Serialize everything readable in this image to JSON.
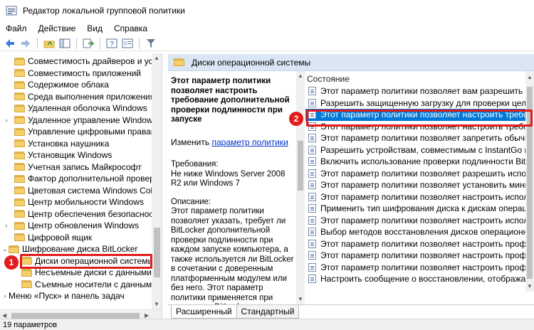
{
  "window": {
    "title": "Редактор локальной групповой политики"
  },
  "menu": [
    "Файл",
    "Действие",
    "Вид",
    "Справка"
  ],
  "toolbar": {
    "icons": [
      "back-icon",
      "forward-icon",
      "up-folder-icon",
      "show-hide-tree-icon",
      "export-list-icon",
      "help-icon",
      "properties-icon",
      "filter-icon"
    ]
  },
  "tree": {
    "items": [
      {
        "label": "Совместимость драйверов и устро",
        "expandable": false
      },
      {
        "label": "Совместимость приложений",
        "expandable": false
      },
      {
        "label": "Содержимое облака",
        "expandable": false
      },
      {
        "label": "Среда выполнения приложения",
        "expandable": false
      },
      {
        "label": "Удаленная оболочка Windows",
        "expandable": false
      },
      {
        "label": "Удаленное управление Windows",
        "expandable": true
      },
      {
        "label": "Управление цифровыми правами W",
        "expandable": false
      },
      {
        "label": "Установка наушника",
        "expandable": false
      },
      {
        "label": "Установщик Windows",
        "expandable": false
      },
      {
        "label": "Учетная запись Майкрософт",
        "expandable": false
      },
      {
        "label": "Фактор дополнительной проверки",
        "expandable": false
      },
      {
        "label": "Цветовая система Windows Color S",
        "expandable": false
      },
      {
        "label": "Центр мобильности Windows",
        "expandable": false
      },
      {
        "label": "Центр обеспечения безопасности",
        "expandable": false
      },
      {
        "label": "Центр обновления Windows",
        "expandable": true
      },
      {
        "label": "Цифровой ящик",
        "expandable": false
      },
      {
        "label": "Шифрование диска BitLocker",
        "expandable": true
      },
      {
        "label": "Диски операционной системы",
        "expandable": false
      },
      {
        "label": "Несъемные диски с данными",
        "expandable": false
      },
      {
        "label": "Съемные носители с данными",
        "expandable": false
      },
      {
        "label": "Меню «Пуск» и панель задач",
        "expandable": true
      }
    ],
    "selected_index": 17
  },
  "pane_header": "Диски операционной системы",
  "description": {
    "heading": "Этот параметр политики позволяет настроить требование дополнительной проверки подлинности при запуске",
    "edit_prefix": "Изменить",
    "edit_link": "параметр политики",
    "requirements_label": "Требования:",
    "requirements_text": "Не ниже Windows Server 2008 R2 или Windows 7",
    "description_label": "Описание:",
    "description_text": "Этот параметр политики позволяет указать, требует ли BitLocker дополнительной проверки подлинности при каждом запуске компьютера, а также используется ли BitLocker в сочетании с доверенным платформенным модулем или без него. Этот параметр политики применяется при включении BitLocker."
  },
  "list": {
    "column_header": "Состояние",
    "items": [
      "Этот параметр политики позволяет вам разрешить целост...",
      "Разрешить защищенную загрузку для проверки целостн...",
      "Этот параметр политики позволяет настроить требовани...",
      "Этот параметр политики позволяет настроить требовани...",
      "Этот параметр политики позволяет запретить обычным ...",
      "Разрешить устройствам, совместимым с InstantGo или H...",
      "Включить использование проверки подлинности BitLock...",
      "Этот параметр политики позволяет разрешить использо...",
      "Этот параметр политики позволяет установить минимал...",
      "Этот параметр политики позволяет настроить использо...",
      "Применить тип шифрования диска к дискам операционн...",
      "Этот параметр политики позволяет настроить использо...",
      "Выбор методов восстановления дисков операционной с...",
      "Этот параметр политики позволяет настроить профиль п...",
      "Этот параметр политики позволяет настроить профиль п...",
      "Этот параметр политики позволяет настроить профиль п...",
      "Настроить сообщение о восстановлении, отображаемое ..."
    ],
    "selected_index": 2
  },
  "tabs": [
    "Расширенный",
    "Стандартный"
  ],
  "active_tab": 0,
  "status": "19 параметров",
  "annotations": {
    "badge1": "1",
    "badge2": "2"
  },
  "colors": {
    "selection": "#0078d7",
    "annotation": "#e21b1b",
    "header_bg": "#dbe6f4"
  }
}
